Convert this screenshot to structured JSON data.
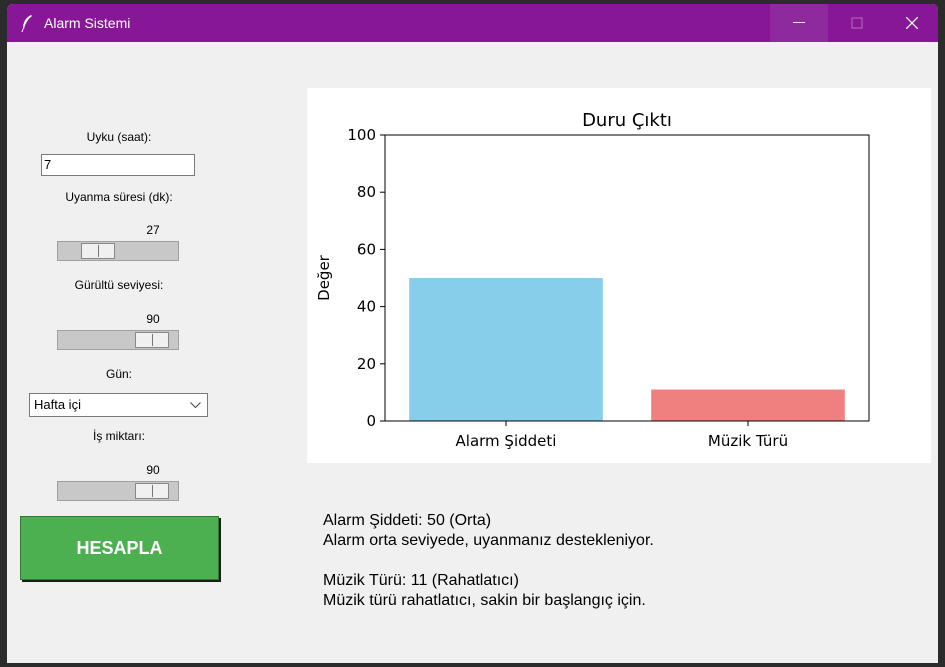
{
  "window": {
    "title": "Alarm Sistemi"
  },
  "controls": {
    "sleep_label": "Uyku (saat):",
    "sleep_value": "7",
    "wake_label": "Uyanma süresi (dk):",
    "wake_value": 27,
    "noise_label": "Gürültü seviyesi:",
    "noise_value": 90,
    "day_label": "Gün:",
    "day_value": "Hafta içi",
    "work_label": "İş miktarı:",
    "work_value": 90,
    "calc_button": "HESAPLA"
  },
  "chart_data": {
    "type": "bar",
    "title": "Duru Çıktı",
    "xlabel": "",
    "ylabel": "Değer",
    "categories": [
      "Alarm Şiddeti",
      "Müzik Türü"
    ],
    "values": [
      50,
      11
    ],
    "colors": [
      "#87ceeb",
      "#f08080"
    ],
    "ylim": [
      0,
      100
    ],
    "yticks": [
      0,
      20,
      40,
      60,
      80,
      100
    ],
    "grid": false
  },
  "results": {
    "line1": "Alarm Şiddeti: 50 (Orta)",
    "line2": "Alarm orta seviyede, uyanmanız destekleniyor.",
    "line3": "Müzik Türü: 11 (Rahatlatıcı)",
    "line4": "Müzik türü rahatlatıcı, sakin bir başlangıç için."
  },
  "icons": {
    "app": "feather-icon",
    "minimize": "minimize-icon",
    "maximize": "maximize-icon",
    "close": "close-icon",
    "dropdown": "chevron-down-icon"
  }
}
